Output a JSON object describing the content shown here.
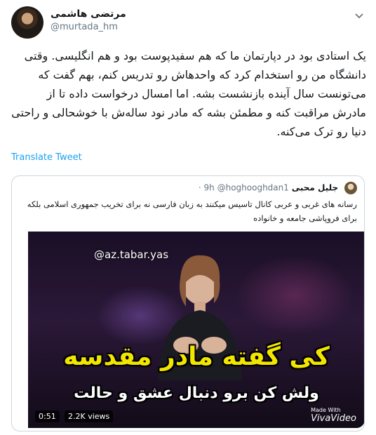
{
  "author": {
    "name": "مرتضی هاشمی",
    "handle": "@murtada_hm"
  },
  "tweet": {
    "text": "یک استادی بود در دپارتمان ما که هم سفیدپوست بود و هم انگلیسی. وقتی دانشگاه من رو استخدام کرد که واحدهاش رو تدریس کنم، بهم گفت که می‌تونست سال آینده بازنشست بشه. اما امسال درخواست داده تا از مادرش مراقبت کنه و مطمئن بشه که  مادر نود ساله‌ش با خوشحالی و راحتی دنیا رو ترک می‌کنه.",
    "translate_label": "Translate Tweet"
  },
  "quoted": {
    "name": "جلیل محبی",
    "handle": "@hoghooghdan1",
    "time": "· 9h",
    "text": "رسانه های غربی و عربی کانال تاسیس میکنند به زبان فارسی نه برای تخریب جمهوری اسلامی بلکه برای فروپاشی جامعه و خانواده"
  },
  "video": {
    "overlay_handle": "@az.tabar.yas",
    "caption_line1": "کی گفته مادر مقدسه",
    "caption_line2": "ولش کن برو دنبال عشق و حالت",
    "duration": "0:51",
    "views": "2.2K views",
    "watermark_small": "Made With",
    "watermark_big": "VivaVideo"
  }
}
